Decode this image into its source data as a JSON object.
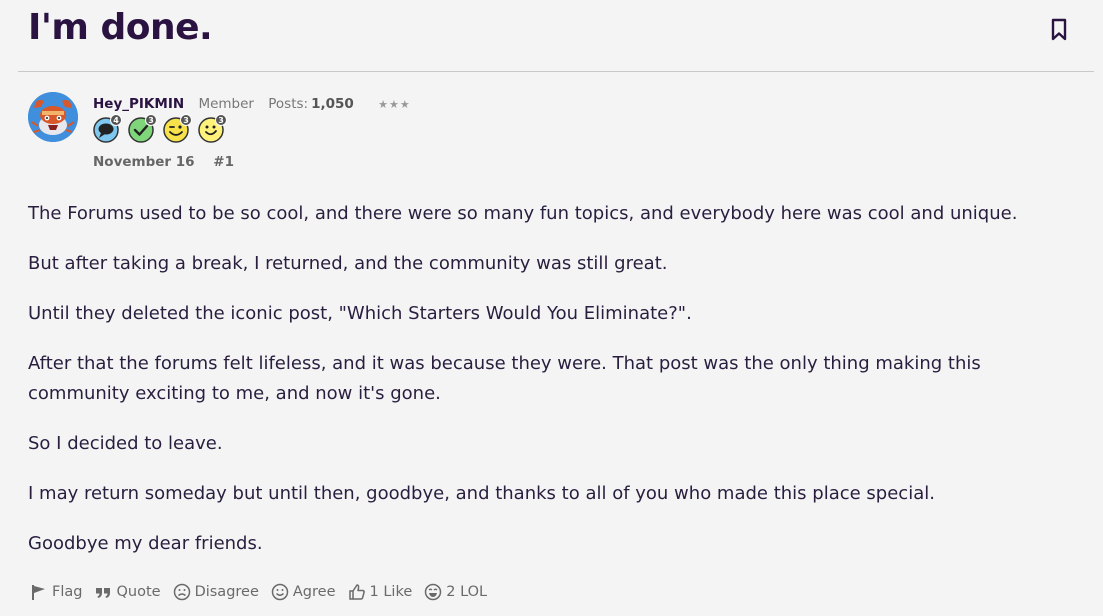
{
  "thread": {
    "title": "I'm done."
  },
  "author": {
    "username": "Hey_PIKMIN",
    "role": "Member",
    "posts_label": "Posts:",
    "posts_count": "1,050",
    "stars": "★★★"
  },
  "badges": [
    {
      "icon": "chat-bubble-icon",
      "count": "4"
    },
    {
      "icon": "checkmark-icon",
      "count": "3"
    },
    {
      "icon": "wink-face-icon",
      "count": "3"
    },
    {
      "icon": "smile-face-icon",
      "count": "3"
    }
  ],
  "post": {
    "date": "November 16",
    "number": "#1",
    "paragraphs": [
      "The Forums used to be so cool, and there were so many fun topics, and everybody here was cool and unique.",
      "But after taking a break, I returned, and the community was still great.",
      "Until they deleted the iconic post, \"Which Starters Would You Eliminate?\".",
      "After that the forums felt lifeless, and it was because they were. That post was the only thing making this community exciting to me, and now it's gone.",
      "So I decided to leave.",
      "I may return someday but until then, goodbye, and thanks to all of you who made this place special.",
      "Goodbye my dear friends."
    ]
  },
  "actions": {
    "flag": "Flag",
    "quote": "Quote",
    "disagree": "Disagree",
    "agree": "Agree",
    "like": "1 Like",
    "lol": "2 LOL"
  },
  "colors": {
    "title": "#2a1241",
    "accent": "#3f8fdd",
    "background": "#f4f4f4"
  }
}
